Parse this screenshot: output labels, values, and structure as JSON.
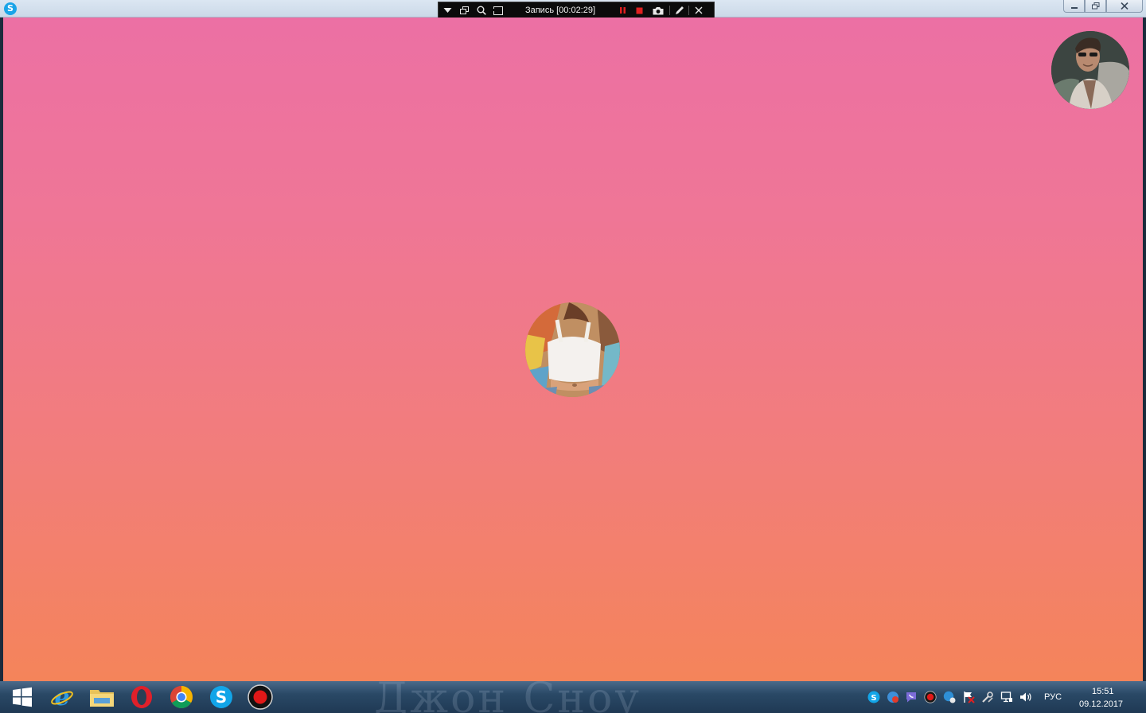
{
  "window": {
    "app_icon": "skype-icon",
    "controls": [
      "minimize-icon",
      "restore-icon",
      "close-icon"
    ]
  },
  "recorder": {
    "label": "Запись [00:02:29]",
    "buttons": [
      "dropdown-arrow-icon",
      "window-select-icon",
      "zoom-icon",
      "region-select-icon",
      "pause-icon",
      "stop-icon",
      "camera-icon",
      "pen-icon",
      "close-icon"
    ],
    "colors": {
      "pause": "#e02020",
      "stop": "#e02020"
    }
  },
  "call": {
    "background_top": "#ec70a4",
    "background_bottom": "#f4845a",
    "self_avatar": "self-video-avatar",
    "remote_avatar": "remote-user-avatar"
  },
  "taskbar": {
    "watermark": "Джон Сноу",
    "pinned": [
      "windows-start-icon",
      "internet-explorer-icon",
      "file-explorer-icon",
      "opera-icon",
      "chrome-icon",
      "skype-icon",
      "recorder-icon"
    ],
    "tray_icons": [
      "skype-tray-icon",
      "update-tray-icon",
      "viber-tray-icon",
      "record-tray-icon",
      "sync-tray-icon",
      "action-center-flag-icon",
      "tools-tray-icon",
      "network-icon",
      "volume-icon"
    ],
    "language": "РУС",
    "time": "15:51",
    "date": "09.12.2017"
  }
}
